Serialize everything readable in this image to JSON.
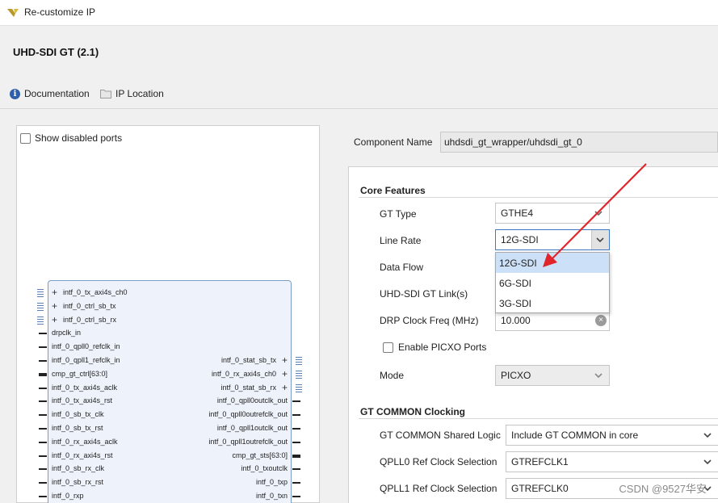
{
  "window": {
    "title": "Re-customize IP"
  },
  "header": {
    "ip_title": "UHD-SDI GT (2.1)",
    "documentation": "Documentation",
    "ip_location": "IP Location"
  },
  "left": {
    "show_disabled_ports": "Show disabled ports",
    "ports_left": [
      "intf_0_tx_axi4s_ch0",
      "intf_0_ctrl_sb_tx",
      "intf_0_ctrl_sb_rx",
      "drpclk_in",
      "intf_0_qpll0_refclk_in",
      "intf_0_qpll1_refclk_in",
      "cmp_gt_ctrl[63:0]",
      "intf_0_tx_axi4s_aclk",
      "intf_0_tx_axi4s_rst",
      "intf_0_sb_tx_clk",
      "intf_0_sb_tx_rst",
      "intf_0_rx_axi4s_aclk",
      "intf_0_rx_axi4s_rst",
      "intf_0_sb_rx_clk",
      "intf_0_sb_rx_rst",
      "intf_0_rxp"
    ],
    "ports_right": [
      "intf_0_stat_sb_tx",
      "intf_0_rx_axi4s_ch0",
      "intf_0_stat_sb_rx",
      "intf_0_qpll0outclk_out",
      "intf_0_qpll0outrefclk_out",
      "intf_0_qpll1outclk_out",
      "intf_0_qpll1outrefclk_out",
      "cmp_gt_sts[63:0]",
      "intf_0_txoutclk",
      "intf_0_txp",
      "intf_0_txn"
    ]
  },
  "component": {
    "label": "Component Name",
    "value": "uhdsdi_gt_wrapper/uhdsdi_gt_0"
  },
  "core": {
    "title": "Core Features",
    "gt_type_label": "GT Type",
    "gt_type_value": "GTHE4",
    "line_rate_label": "Line Rate",
    "line_rate_value": "12G-SDI",
    "data_flow_label": "Data Flow",
    "links_label": "UHD-SDI GT Link(s)",
    "drp_label": "DRP Clock Freq (MHz)",
    "drp_value": "10.000",
    "picxo_label": "Enable PICXO Ports",
    "mode_label": "Mode",
    "mode_value": "PICXO"
  },
  "dropdown": {
    "options": [
      "12G-SDI",
      "6G-SDI",
      "3G-SDI"
    ]
  },
  "common": {
    "title": "GT COMMON Clocking",
    "shared_label": "GT COMMON Shared Logic",
    "shared_value": "Include GT COMMON in core",
    "qpll0_label": "QPLL0 Ref Clock Selection",
    "qpll0_value": "GTREFCLK1",
    "qpll1_label": "QPLL1 Ref Clock Selection",
    "qpll1_value": "GTREFCLK0"
  },
  "watermark": "CSDN @9527华安",
  "colors": {
    "accent": "#3c78c3",
    "arrow": "#e0262c",
    "selected": "#cce0f7"
  }
}
